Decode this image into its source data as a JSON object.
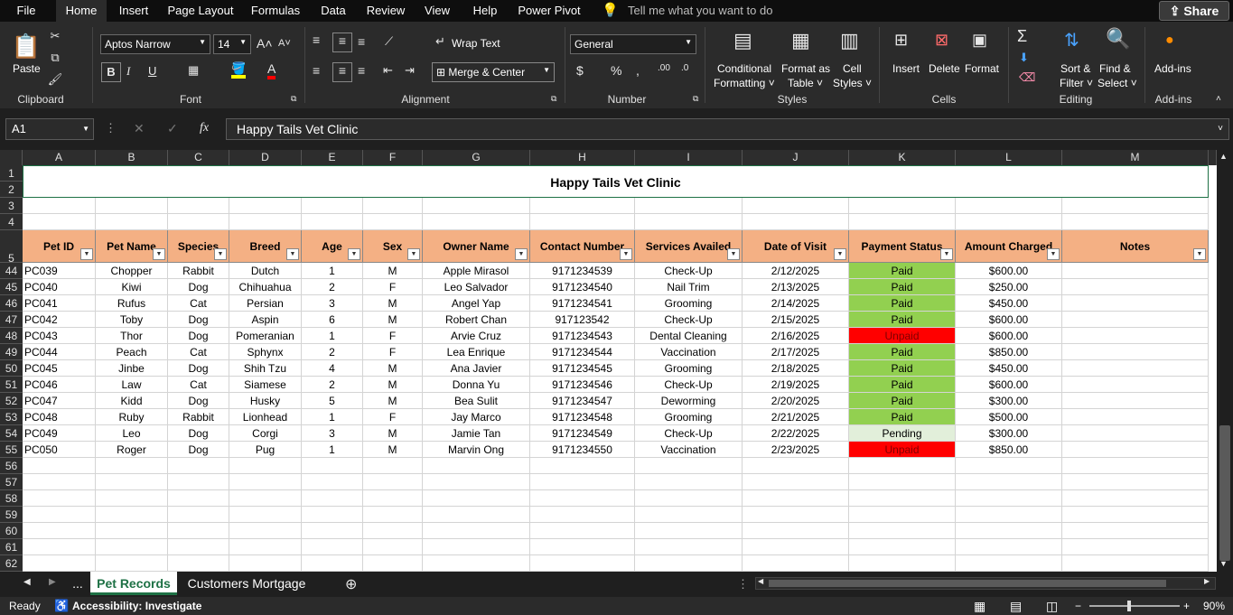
{
  "menu": {
    "items": [
      "File",
      "Home",
      "Insert",
      "Page Layout",
      "Formulas",
      "Data",
      "Review",
      "View",
      "Help",
      "Power Pivot"
    ],
    "tell_me": "Tell me what you want to do",
    "share": "Share"
  },
  "ribbon": {
    "clipboard": {
      "paste": "Paste",
      "label": "Clipboard"
    },
    "font": {
      "name": "Aptos Narrow",
      "size": "14",
      "label": "Font"
    },
    "alignment": {
      "wrap": "Wrap Text",
      "merge": "Merge & Center",
      "label": "Alignment"
    },
    "number": {
      "format": "General",
      "label": "Number"
    },
    "styles": {
      "cond1": "Conditional",
      "cond2": "Formatting",
      "fmt1": "Format as",
      "fmt2": "Table",
      "cell1": "Cell",
      "cell2": "Styles",
      "label": "Styles"
    },
    "cells": {
      "insert": "Insert",
      "delete": "Delete",
      "format": "Format",
      "label": "Cells"
    },
    "editing": {
      "sort1": "Sort &",
      "sort2": "Filter",
      "find1": "Find &",
      "find2": "Select",
      "label": "Editing"
    },
    "addins": {
      "btn": "Add-ins",
      "label": "Add-ins"
    }
  },
  "formula_bar": {
    "name_box": "A1",
    "formula": "Happy Tails Vet Clinic"
  },
  "columns": [
    "A",
    "B",
    "C",
    "D",
    "E",
    "F",
    "G",
    "H",
    "I",
    "J",
    "K",
    "L",
    "M"
  ],
  "title": "Happy Tails Vet Clinic",
  "headers": [
    "Pet ID",
    "Pet Name",
    "Species",
    "Breed",
    "Age",
    "Sex",
    "Owner Name",
    "Contact Number",
    "Services Availed",
    "Date of Visit",
    "Payment Status",
    "Amount Charged",
    "Notes"
  ],
  "rows": [
    {
      "rn": "44",
      "cells": [
        "PC039",
        "Chopper",
        "Rabbit",
        "Dutch",
        "1",
        "M",
        "Apple Mirasol",
        "9171234539",
        "Check-Up",
        "2/12/2025",
        "Paid",
        "$600.00",
        ""
      ]
    },
    {
      "rn": "45",
      "cells": [
        "PC040",
        "Kiwi",
        "Dog",
        "Chihuahua",
        "2",
        "F",
        "Leo Salvador",
        "9171234540",
        "Nail Trim",
        "2/13/2025",
        "Paid",
        "$250.00",
        ""
      ]
    },
    {
      "rn": "46",
      "cells": [
        "PC041",
        "Rufus",
        "Cat",
        "Persian",
        "3",
        "M",
        "Angel Yap",
        "9171234541",
        "Grooming",
        "2/14/2025",
        "Paid",
        "$450.00",
        ""
      ]
    },
    {
      "rn": "47",
      "cells": [
        "PC042",
        "Toby",
        "Dog",
        "Aspin",
        "6",
        "M",
        "Robert Chan",
        "917123542",
        "Check-Up",
        "2/15/2025",
        "Paid",
        "$600.00",
        ""
      ]
    },
    {
      "rn": "48",
      "cells": [
        "PC043",
        "Thor",
        "Dog",
        "Pomeranian",
        "1",
        "F",
        "Arvie Cruz",
        "9171234543",
        "Dental Cleaning",
        "2/16/2025",
        "Unpaid",
        "$600.00",
        ""
      ]
    },
    {
      "rn": "49",
      "cells": [
        "PC044",
        "Peach",
        "Cat",
        "Sphynx",
        "2",
        "F",
        "Lea Enrique",
        "9171234544",
        "Vaccination",
        "2/17/2025",
        "Paid",
        "$850.00",
        ""
      ]
    },
    {
      "rn": "50",
      "cells": [
        "PC045",
        "Jinbe",
        "Dog",
        "Shih Tzu",
        "4",
        "M",
        "Ana Javier",
        "9171234545",
        "Grooming",
        "2/18/2025",
        "Paid",
        "$450.00",
        ""
      ]
    },
    {
      "rn": "51",
      "cells": [
        "PC046",
        "Law",
        "Cat",
        "Siamese",
        "2",
        "M",
        "Donna Yu",
        "9171234546",
        "Check-Up",
        "2/19/2025",
        "Paid",
        "$600.00",
        ""
      ]
    },
    {
      "rn": "52",
      "cells": [
        "PC047",
        "Kidd",
        "Dog",
        "Husky",
        "5",
        "M",
        "Bea Sulit",
        "9171234547",
        "Deworming",
        "2/20/2025",
        "Paid",
        "$300.00",
        ""
      ]
    },
    {
      "rn": "53",
      "cells": [
        "PC048",
        "Ruby",
        "Rabbit",
        "Lionhead",
        "1",
        "F",
        "Jay Marco",
        "9171234548",
        "Grooming",
        "2/21/2025",
        "Paid",
        "$500.00",
        ""
      ]
    },
    {
      "rn": "54",
      "cells": [
        "PC049",
        "Leo",
        "Dog",
        "Corgi",
        "3",
        "M",
        "Jamie Tan",
        "9171234549",
        "Check-Up",
        "2/22/2025",
        "Pending",
        "$300.00",
        ""
      ]
    },
    {
      "rn": "55",
      "cells": [
        "PC050",
        "Roger",
        "Dog",
        "Pug",
        "1",
        "M",
        "Marvin Ong",
        "9171234550",
        "Vaccination",
        "2/23/2025",
        "Unpaid",
        "$850.00",
        ""
      ]
    }
  ],
  "top_rows": [
    "1",
    "2",
    "3",
    "4",
    "5"
  ],
  "empty_rows": [
    "56",
    "57",
    "58",
    "59",
    "60",
    "61",
    "62"
  ],
  "status_colors": {
    "Paid": "#92d050",
    "Unpaid": "#ff0000",
    "Pending": "#e2efda"
  },
  "sheets": {
    "more": "...",
    "active": "Pet Records",
    "other": "Customers Mortgage"
  },
  "statusbar": {
    "ready": "Ready",
    "accessibility": "Accessibility: Investigate",
    "zoom": "90%"
  }
}
